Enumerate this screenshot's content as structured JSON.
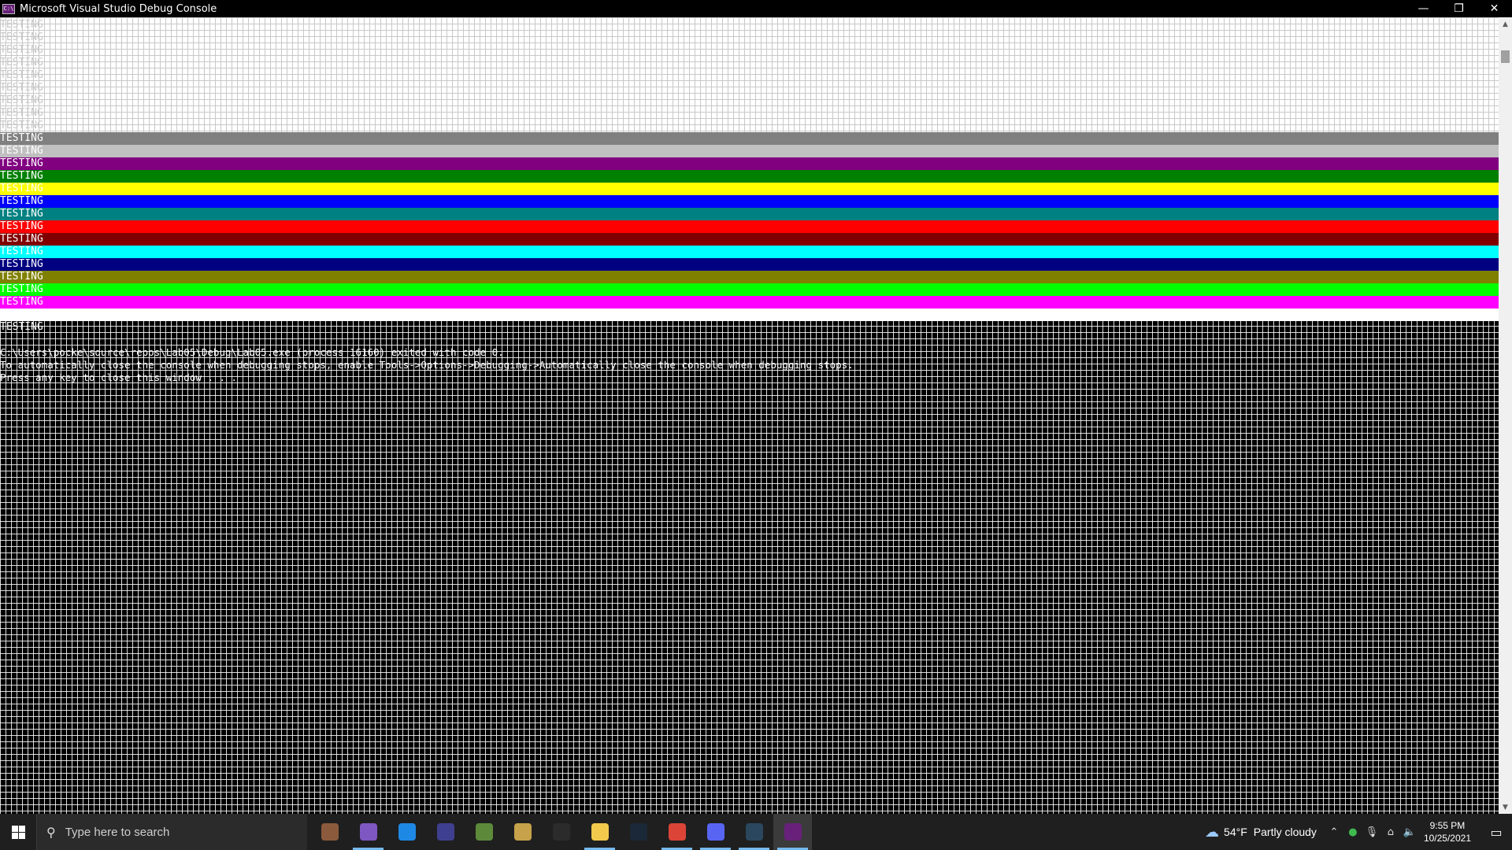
{
  "window": {
    "title": "Microsoft Visual Studio Debug Console",
    "icon_text": "C:\\",
    "controls": {
      "minimize": "—",
      "restore": "❐",
      "close": "✕"
    }
  },
  "console": {
    "repeat_text": "TESTING",
    "faded_lines": [
      "TESTING",
      "TESTING",
      "TESTING",
      "TESTING",
      "TESTING",
      "TESTING",
      "TESTING",
      "TESTING",
      "TESTING"
    ],
    "bands": [
      {
        "bg": "#808080",
        "fg": "#ffffff",
        "text": "TESTING"
      },
      {
        "bg": "#c0c0c0",
        "fg": "#ffffff",
        "text": "TESTING"
      },
      {
        "bg": "#800080",
        "fg": "#ffffff",
        "text": "TESTING"
      },
      {
        "bg": "#008000",
        "fg": "#ffffff",
        "text": "TESTING"
      },
      {
        "bg": "#ffff00",
        "fg": "#ffffff",
        "text": "TESTING"
      },
      {
        "bg": "#0000ff",
        "fg": "#ffffff",
        "text": "TESTING"
      },
      {
        "bg": "#008080",
        "fg": "#ffffff",
        "text": "TESTING"
      },
      {
        "bg": "#ff0000",
        "fg": "#ffffff",
        "text": "TESTING"
      },
      {
        "bg": "#800000",
        "fg": "#ffffff",
        "text": "TESTING"
      },
      {
        "bg": "#00ffff",
        "fg": "#ffffff",
        "text": "TESTING"
      },
      {
        "bg": "#000080",
        "fg": "#ffffff",
        "text": "TESTING"
      },
      {
        "bg": "#808000",
        "fg": "#ffffff",
        "text": "TESTING"
      },
      {
        "bg": "#00ff00",
        "fg": "#ffffff",
        "text": "TESTING"
      },
      {
        "bg": "#ff00ff",
        "fg": "#ffffff",
        "text": "TESTING"
      },
      {
        "bg": "#ffffff",
        "fg": "#ffffff",
        "text": ""
      }
    ],
    "last_testing": "TESTING",
    "messages": [
      "C:\\Users\\pocke\\source\\repos\\Lab05\\Debug\\Lab05.exe (process 16160) exited with code 0.",
      "To automatically close the console when debugging stops, enable Tools->Options->Debugging->Automatically close the console when debugging stops.",
      "Press any key to close this window . . ."
    ]
  },
  "taskbar": {
    "search_placeholder": "Type here to search",
    "apps": [
      {
        "name": "app-1-icon",
        "color": "#8b5a3c",
        "running": false,
        "active": false
      },
      {
        "name": "visual-studio-icon",
        "color": "#7e57c2",
        "running": true,
        "active": false
      },
      {
        "name": "vscode-icon",
        "color": "#1e88e5",
        "running": false,
        "active": false
      },
      {
        "name": "eclipse-icon",
        "color": "#3f3f8f",
        "running": false,
        "active": false
      },
      {
        "name": "minecraft-icon",
        "color": "#5d8a3a",
        "running": false,
        "active": false
      },
      {
        "name": "league-icon",
        "color": "#c7a24a",
        "running": false,
        "active": false
      },
      {
        "name": "app-7-icon",
        "color": "#2b2b2b",
        "running": false,
        "active": false
      },
      {
        "name": "file-explorer-icon",
        "color": "#f2c94c",
        "running": true,
        "active": false
      },
      {
        "name": "steam-icon",
        "color": "#1b2838",
        "running": false,
        "active": false
      },
      {
        "name": "chrome-icon",
        "color": "#db4437",
        "running": true,
        "active": false
      },
      {
        "name": "discord-icon",
        "color": "#5865f2",
        "running": true,
        "active": false
      },
      {
        "name": "steam-2-icon",
        "color": "#2a475e",
        "running": true,
        "active": false
      },
      {
        "name": "debug-console-icon",
        "color": "#68217a",
        "running": true,
        "active": true
      }
    ],
    "weather": {
      "temp": "54°F",
      "desc": "Partly cloudy"
    },
    "clock": {
      "time": "9:55 PM",
      "date": "10/25/2021"
    }
  }
}
